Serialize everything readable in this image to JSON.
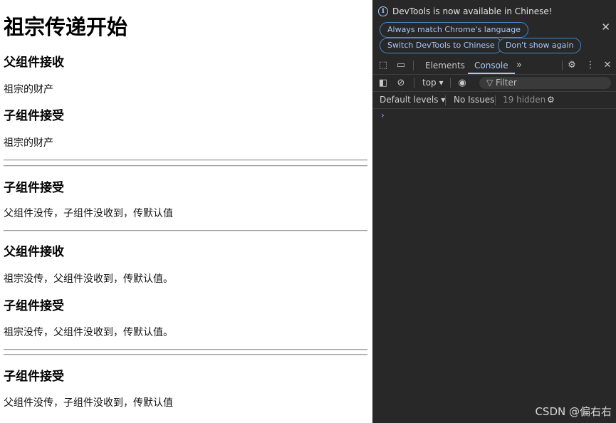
{
  "page": {
    "title": "祖宗传递开始",
    "block1": {
      "h_parent": "父组件接收",
      "p_parent": "祖宗的财产",
      "h_child": "子组件接受",
      "p_child": "祖宗的财产"
    },
    "block2": {
      "h_child": "子组件接受",
      "p_child": "父组件没传，子组件没收到，传默认值"
    },
    "block3": {
      "h_parent": "父组件接收",
      "p_parent": "祖宗没传，父组件没收到，传默认值。",
      "h_child": "子组件接受",
      "p_child": "祖宗没传，父组件没收到，传默认值。"
    },
    "block4": {
      "h_child": "子组件接受",
      "p_child": "父组件没传，子组件没收到，传默认值"
    }
  },
  "devtools": {
    "notice": "DevTools is now available in Chinese!",
    "btn_match": "Always match Chrome's language",
    "btn_switch": "Switch DevTools to Chinese",
    "btn_dont_show": "Don't show again",
    "tabs": [
      "Elements",
      "Console"
    ],
    "active_tab": "Console",
    "context": "top",
    "filter_placeholder": "Filter",
    "default_levels": "Default levels",
    "issues": "No Issues",
    "hidden": "19 hidden",
    "prompt_glyph": "›",
    "colors": {
      "bg": "#282828",
      "accent": "#a8c7fa"
    }
  },
  "watermark": "CSDN @偏右右"
}
